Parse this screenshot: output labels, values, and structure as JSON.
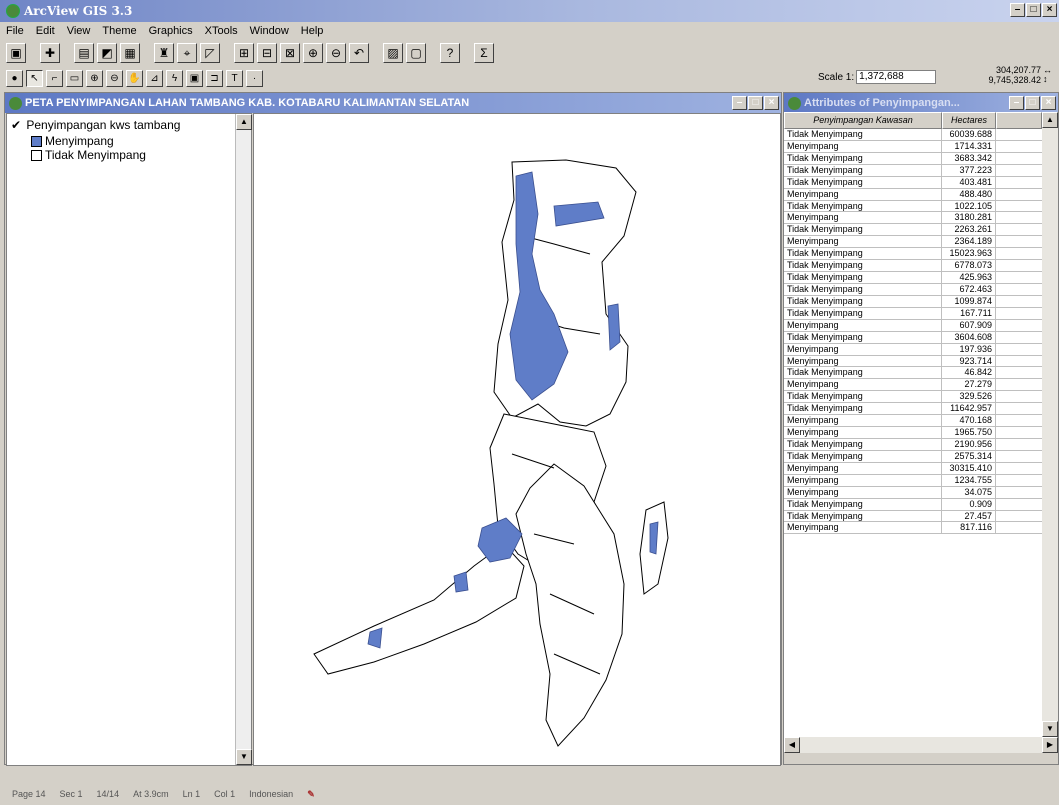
{
  "app": {
    "title": "ArcView GIS 3.3"
  },
  "menu": [
    "File",
    "Edit",
    "View",
    "Theme",
    "Graphics",
    "XTools",
    "Window",
    "Help"
  ],
  "toolbar": {
    "scale_label": "Scale 1:",
    "scale_value": "1,372,688",
    "coord_x": "304,207.77",
    "coord_y": "9,745,328.42"
  },
  "view": {
    "title": "PETA PENYIMPANGAN LAHAN TAMBANG KAB. KOTABARU KALIMANTAN SELATAN",
    "theme_name": "Penyimpangan kws tambang",
    "legend": [
      {
        "label": "Menyimpang",
        "color": "#5f7dc8"
      },
      {
        "label": "Tidak Menyimpang",
        "color": "#ffffff"
      }
    ]
  },
  "attributes": {
    "title": "Attributes of Penyimpangan...",
    "columns": [
      "Penyimpangan Kawasan",
      "Hectares"
    ],
    "rows": [
      [
        "Tidak Menyimpang",
        "60039.688"
      ],
      [
        "Menyimpang",
        "1714.331"
      ],
      [
        "Tidak Menyimpang",
        "3683.342"
      ],
      [
        "Tidak Menyimpang",
        "377.223"
      ],
      [
        "Tidak Menyimpang",
        "403.481"
      ],
      [
        "Menyimpang",
        "488.480"
      ],
      [
        "Tidak Menyimpang",
        "1022.105"
      ],
      [
        "Menyimpang",
        "3180.281"
      ],
      [
        "Tidak Menyimpang",
        "2263.261"
      ],
      [
        "Menyimpang",
        "2364.189"
      ],
      [
        "Tidak Menyimpang",
        "15023.963"
      ],
      [
        "Tidak Menyimpang",
        "6778.073"
      ],
      [
        "Tidak Menyimpang",
        "425.963"
      ],
      [
        "Tidak Menyimpang",
        "672.463"
      ],
      [
        "Tidak Menyimpang",
        "1099.874"
      ],
      [
        "Tidak Menyimpang",
        "167.711"
      ],
      [
        "Menyimpang",
        "607.909"
      ],
      [
        "Tidak Menyimpang",
        "3604.608"
      ],
      [
        "Menyimpang",
        "197.936"
      ],
      [
        "Menyimpang",
        "923.714"
      ],
      [
        "Tidak Menyimpang",
        "46.842"
      ],
      [
        "Menyimpang",
        "27.279"
      ],
      [
        "Tidak Menyimpang",
        "329.526"
      ],
      [
        "Tidak Menyimpang",
        "11642.957"
      ],
      [
        "Menyimpang",
        "470.168"
      ],
      [
        "Menyimpang",
        "1965.750"
      ],
      [
        "Tidak Menyimpang",
        "2190.956"
      ],
      [
        "Tidak Menyimpang",
        "2575.314"
      ],
      [
        "Menyimpang",
        "30315.410"
      ],
      [
        "Menyimpang",
        "1234.755"
      ],
      [
        "Menyimpang",
        "34.075"
      ],
      [
        "Tidak Menyimpang",
        "0.909"
      ],
      [
        "Tidak Menyimpang",
        "27.457"
      ],
      [
        "Menyimpang",
        "817.116"
      ]
    ]
  },
  "statusbar": {
    "page": "Page 14",
    "sec": "Sec 1",
    "pages": "14/14",
    "at": "At 3.9cm",
    "ln": "Ln 1",
    "col": "Col 1",
    "language": "Indonesian"
  }
}
